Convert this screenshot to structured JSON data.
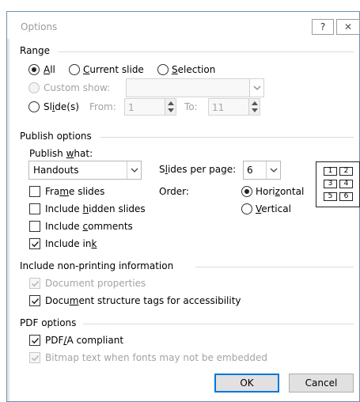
{
  "dialog": {
    "title": "Options",
    "help_glyph": "?",
    "close_glyph": "✕"
  },
  "range": {
    "group_label": "Range",
    "all_label": "All",
    "all_checked": true,
    "current_slide_label": "Current slide",
    "selection_label": "Selection",
    "custom_show_label": "Custom show:",
    "slides_label": "Slide(s)",
    "from_label": "From:",
    "from_value": "1",
    "to_label": "To:",
    "to_value": "11"
  },
  "publish": {
    "group_label": "Publish options",
    "publish_what_label": "Publish what:",
    "publish_what_value": "Handouts",
    "slides_per_page_label": "Slides per page:",
    "slides_per_page_value": "6",
    "order_label": "Order:",
    "horizontal_label": "Horizontal",
    "horizontal_checked": true,
    "vertical_label": "Vertical",
    "frame_slides_label": "Frame slides",
    "frame_slides_checked": false,
    "include_hidden_label": "Include hidden slides",
    "include_hidden_checked": false,
    "include_comments_label": "Include comments",
    "include_comments_checked": false,
    "include_ink_label": "Include ink",
    "include_ink_checked": true,
    "grid_cells": [
      "1",
      "2",
      "3",
      "4",
      "5",
      "6"
    ]
  },
  "nonprinting": {
    "group_label": "Include non-printing information",
    "document_properties_label": "Document properties",
    "document_properties_checked": true,
    "structure_tags_label": "Document structure tags for accessibility",
    "structure_tags_checked": true
  },
  "pdf": {
    "group_label": "PDF options",
    "pdfa_label": "PDF/A compliant",
    "pdfa_checked": true,
    "bitmap_text_label": "Bitmap text when fonts may not be embedded",
    "bitmap_text_checked": true
  },
  "buttons": {
    "ok_label": "OK",
    "cancel_label": "Cancel"
  },
  "colors": {
    "accent": "#0078d7",
    "disabled_text": "#a3a3a3",
    "window_border": "#6e8fb6"
  }
}
